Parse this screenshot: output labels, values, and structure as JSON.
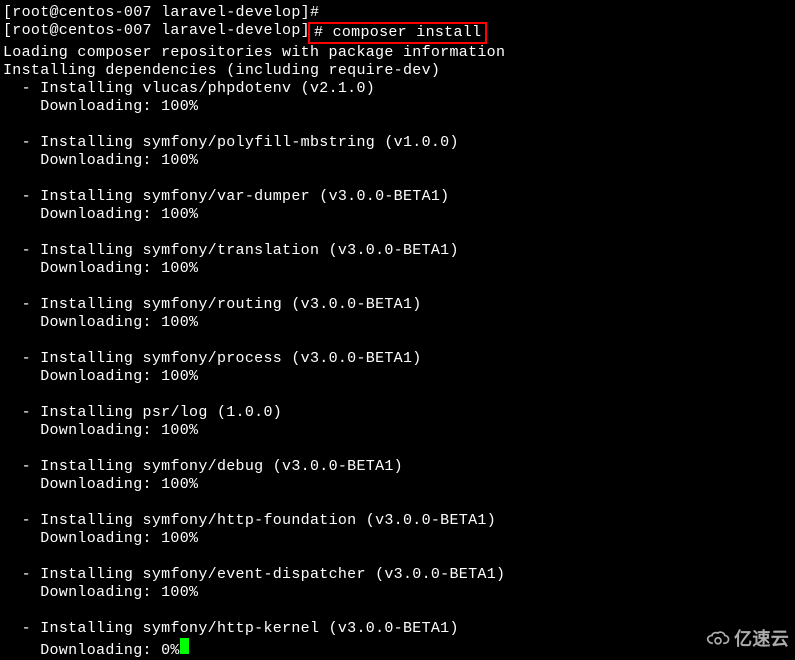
{
  "prompt1": {
    "text": "[root@centos-007 laravel-develop]# "
  },
  "prompt2": {
    "text": "[root@centos-007 laravel-develop]",
    "hash": "# ",
    "command": "composer install"
  },
  "loading_line": "Loading composer repositories with package information",
  "installing_deps": "Installing dependencies (including require-dev)",
  "packages": [
    {
      "dash": "  - ",
      "install": "Installing vlucas/phpdotenv (v2.1.0)",
      "download": "    Downloading: 100%"
    },
    {
      "dash": "  - ",
      "install": "Installing symfony/polyfill-mbstring (v1.0.0)",
      "download": "    Downloading: 100%"
    },
    {
      "dash": "  - ",
      "install": "Installing symfony/var-dumper (v3.0.0-BETA1)",
      "download": "    Downloading: 100%"
    },
    {
      "dash": "  - ",
      "install": "Installing symfony/translation (v3.0.0-BETA1)",
      "download": "    Downloading: 100%"
    },
    {
      "dash": "  - ",
      "install": "Installing symfony/routing (v3.0.0-BETA1)",
      "download": "    Downloading: 100%"
    },
    {
      "dash": "  - ",
      "install": "Installing symfony/process (v3.0.0-BETA1)",
      "download": "    Downloading: 100%"
    },
    {
      "dash": "  - ",
      "install": "Installing psr/log (1.0.0)",
      "download": "    Downloading: 100%"
    },
    {
      "dash": "  - ",
      "install": "Installing symfony/debug (v3.0.0-BETA1)",
      "download": "    Downloading: 100%"
    },
    {
      "dash": "  - ",
      "install": "Installing symfony/http-foundation (v3.0.0-BETA1)",
      "download": "    Downloading: 100%"
    },
    {
      "dash": "  - ",
      "install": "Installing symfony/event-dispatcher (v3.0.0-BETA1)",
      "download": "    Downloading: 100%"
    },
    {
      "dash": "  - ",
      "install": "Installing symfony/http-kernel (v3.0.0-BETA1)",
      "download": "    Downloading: 0%"
    }
  ],
  "watermark": "亿速云"
}
